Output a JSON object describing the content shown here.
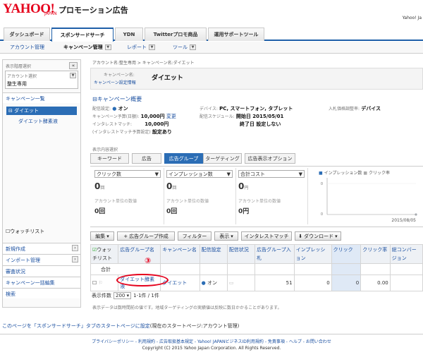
{
  "header": {
    "logo": "YAHOO!",
    "logo_sub": "JAPAN",
    "product": "プロモーション広告",
    "user": "Yahoo! Jа"
  },
  "tabs": [
    "ダッシュボード",
    "スポンサードサーチ",
    "YDN",
    "Twitterプロモ商品",
    "運用サポートツール"
  ],
  "subnav": {
    "account": "アカウント管理",
    "campaign": "キャンペーン管理",
    "report": "レポート",
    "tools": "ツール"
  },
  "sidebar": {
    "heading": "表示階層選択",
    "account_label": "アカウント選択",
    "account_value": "整生専用",
    "campaign_list": "キャンペーン一覧",
    "campaign": "ダイエット",
    "adgroup": "ダイエット酵素液",
    "watchlist": "ウォッチリスト",
    "nav": [
      "新規作成",
      "インポート管理",
      "審査状況",
      "キャンペーン一括編集",
      "検索"
    ]
  },
  "breadcrumb": "アカウント名:整生専用  >  キャンペーン名:ダイエット",
  "campaign": {
    "name_label": "キャンペーン名:",
    "settings_link": "キャンペーン設定情報",
    "name": "ダイエット"
  },
  "overview": {
    "title": "キャンペーン概要",
    "status_label": "配信設定:",
    "status": "オン",
    "budget_label": "キャンペーン予算(日額):",
    "budget": "10,000円",
    "budget_change": "変更",
    "instream_label": "インタレストマッチ:",
    "instream": "10,000円",
    "instream_budget_label": "(インタレストマッチ予算設定)",
    "instream_budget": "設定あり",
    "device_label": "デバイス:",
    "device": "PC, スマートフォン, タブレット",
    "schedule_label": "配信スケジュール:",
    "start": "開始日 2015/05/01",
    "end": "終了日 設定しない",
    "bid_label": "入札価格調整率:",
    "bid": "デバイス"
  },
  "view": {
    "label": "表示内容選択",
    "tabs": [
      "キーワード",
      "広告",
      "広告グループ",
      "ターゲティング",
      "広告表示オプション"
    ]
  },
  "metrics": [
    {
      "select": "クリック数",
      "value": "0",
      "unit": "回",
      "sub_label": "アカウント単位の数値",
      "sub_value": "0回"
    },
    {
      "select": "インプレッション数",
      "value": "0",
      "unit": "回",
      "sub_label": "アカウント単位の数値",
      "sub_value": "0回"
    },
    {
      "select": "合計コスト",
      "value": "0",
      "unit": "円",
      "sub_label": "アカウント単位の数値",
      "sub_value": "0円"
    }
  ],
  "chart_data": {
    "type": "line",
    "series": [
      {
        "name": "インプレッション数",
        "values": [
          0
        ]
      },
      {
        "name": "クリック率",
        "values": [
          0
        ]
      }
    ],
    "x": [
      "2015/08/05"
    ],
    "ylim": [
      0,
      100
    ]
  },
  "toolbar": {
    "edit": "編集",
    "add_group": "広告グループ作成",
    "filter": "フィルター",
    "display": "表示",
    "instream": "インタレストマッチ",
    "download": "ダウンロード"
  },
  "table": {
    "headers": [
      "ウォッチリスト",
      "広告グループ名",
      "キャンペーン名",
      "配信設定",
      "配信状況",
      "広告グループ入札",
      "インプレッション",
      "クリック",
      "クリック率",
      "総コンバージョン"
    ],
    "total_label": "合計",
    "row": {
      "adgroup": "ダイエット酵素液",
      "campaign": "ダイエット",
      "status": "オン",
      "bid": "51",
      "imp": "0",
      "click": "0",
      "cost": "0.00"
    }
  },
  "pager": {
    "label": "表示件数",
    "size": "200",
    "range": "1-1件 / 1件"
  },
  "note": "表示データは数時間前の値です。地域ターゲティングの実績値は反映に数日かかることがあります。",
  "annotation": "③",
  "footer": {
    "startpage": "このページを「スポンサードサーチ」タブのスタートページに設定",
    "startpage_current": "(現在のスタートページ:アカウント管理)",
    "links": "プライバシーポリシー - 利用規約 - 広告取扱基本規定 - Yahoo! JAPANビジネスID利用規約 - 免責事項 - ヘルプ - お問い合わせ",
    "copyright": "Copyright (C) 2015 Yahoo Japan Corporation. All Rights Reserved."
  }
}
